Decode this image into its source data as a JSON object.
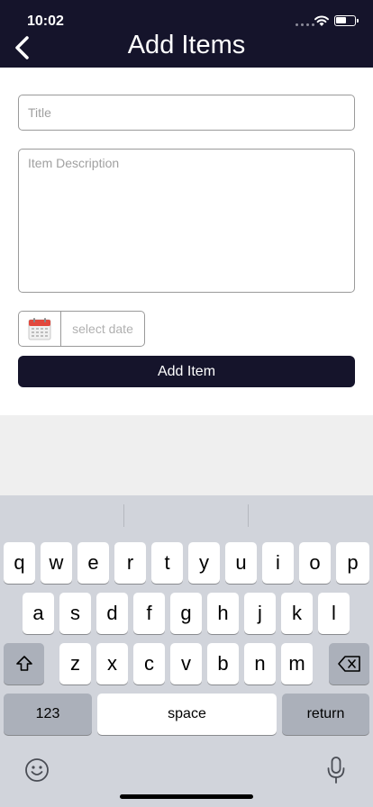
{
  "status_bar": {
    "time": "10:02"
  },
  "header": {
    "title": "Add Items"
  },
  "form": {
    "title_placeholder": "Title",
    "description_placeholder": "Item Description",
    "date_placeholder": "select date",
    "add_button_label": "Add Item"
  },
  "keyboard": {
    "row1": [
      "q",
      "w",
      "e",
      "r",
      "t",
      "y",
      "u",
      "i",
      "o",
      "p"
    ],
    "row2": [
      "a",
      "s",
      "d",
      "f",
      "g",
      "h",
      "j",
      "k",
      "l"
    ],
    "row3": [
      "z",
      "x",
      "c",
      "v",
      "b",
      "n",
      "m"
    ],
    "numbers_label": "123",
    "space_label": "space",
    "return_label": "return"
  },
  "colors": {
    "header_bg": "#15142b",
    "button_bg": "#15142b"
  }
}
